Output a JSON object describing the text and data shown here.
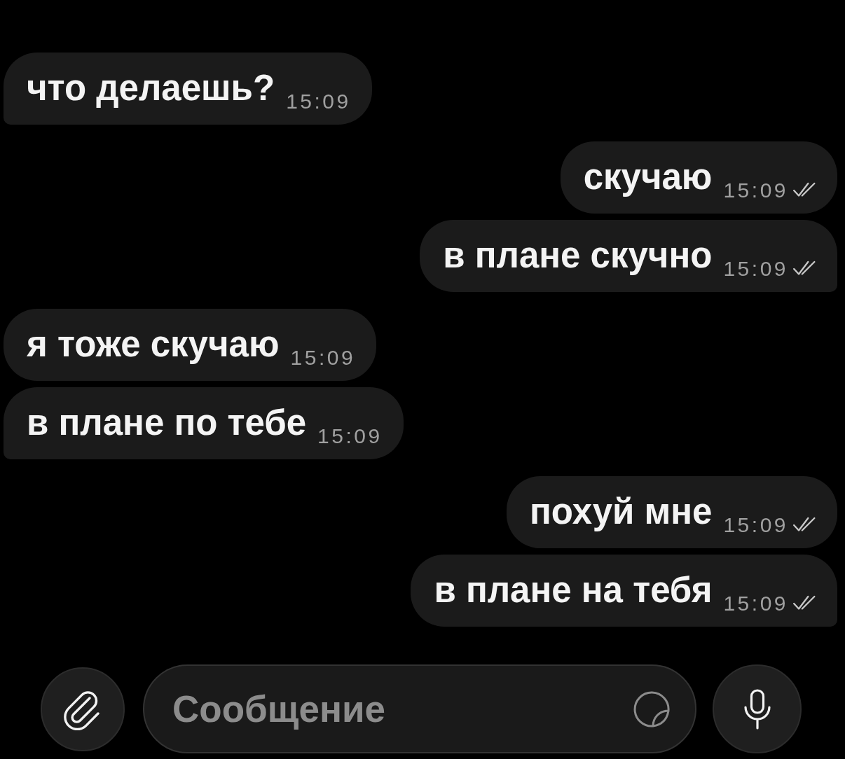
{
  "messages": [
    {
      "kind": "incoming",
      "text": "что делаешь?",
      "time": "15:09"
    },
    {
      "kind": "outgoing",
      "text": "скучаю",
      "time": "15:09",
      "read": true
    },
    {
      "kind": "outgoing",
      "text": "в плане скучно",
      "time": "15:09",
      "read": true
    },
    {
      "kind": "incoming",
      "text": "я тоже скучаю",
      "time": "15:09"
    },
    {
      "kind": "incoming",
      "text": "в плане по тебе",
      "time": "15:09"
    },
    {
      "kind": "outgoing",
      "text": "похуй мне",
      "time": "15:09",
      "read": true
    },
    {
      "kind": "outgoing",
      "text": "в плане на тебя",
      "time": "15:09",
      "read": true
    }
  ],
  "composer": {
    "placeholder": "Сообщение"
  }
}
